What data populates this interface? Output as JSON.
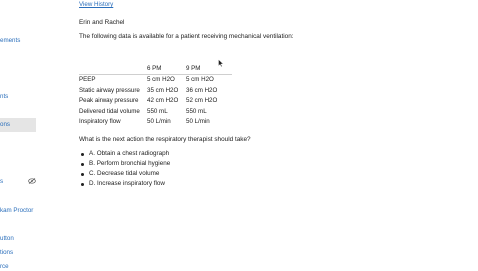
{
  "sidebar": {
    "items": [
      {
        "label": "ements"
      },
      {
        "label": "nts"
      },
      {
        "label": "ons"
      },
      {
        "label": "s"
      },
      {
        "label": "kam Proctor"
      },
      {
        "label": "utton"
      },
      {
        "label": "tions"
      },
      {
        "label": "rce"
      }
    ],
    "hidden_icon": "eye-slash-icon"
  },
  "main": {
    "history_link": "View History",
    "from": "Erin and Rachel",
    "prompt": "The following data is available for a patient receiving mechanical ventilation:",
    "table": {
      "headers": [
        "",
        "6 PM",
        "9 PM"
      ],
      "rows": [
        [
          "PEEP",
          "5 cm H2O",
          "5 cm H2O"
        ],
        [
          "Static airway pressure",
          "35 cm H2O",
          "36 cm H2O"
        ],
        [
          "Peak airway pressure",
          "42 cm H2O",
          "52 cm H2O"
        ],
        [
          "Delivered tidal volume",
          "550 mL",
          "550 mL"
        ],
        [
          "Inspiratory flow",
          "50 L/min",
          "50 L/min"
        ]
      ]
    },
    "question": "What is the next action the respiratory therapist should take?",
    "options": [
      "A.  Obtain a chest radiograph",
      "B.  Perform bronchial hygiene",
      "C.  Decrease tidal volume",
      "D.  Increase inspiratory flow"
    ]
  },
  "colors": {
    "link": "#2a6ebb",
    "active_bg": "#e5e5e5",
    "text": "#222222"
  }
}
